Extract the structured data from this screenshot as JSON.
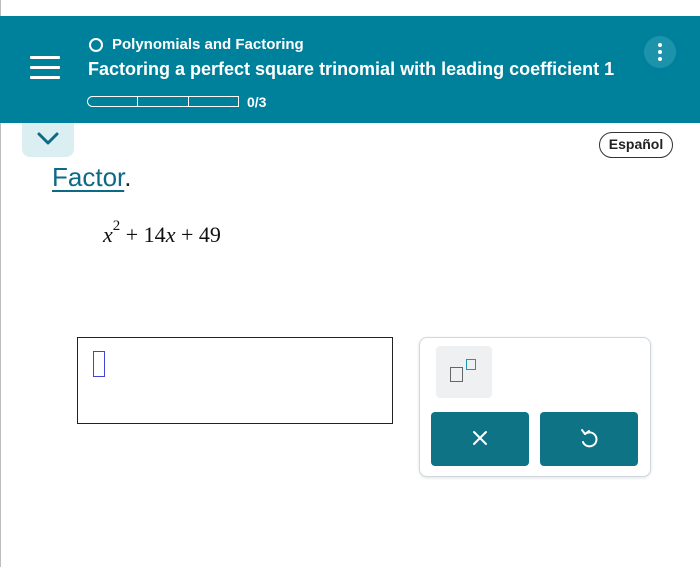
{
  "header": {
    "topic": "Polynomials and Factoring",
    "lesson": "Factoring a perfect square trinomial with leading coefficient 1",
    "progress_text": "0/3",
    "progress_fraction": 0,
    "background_color": "#00819b"
  },
  "language_button": {
    "label": "Español"
  },
  "problem": {
    "instruction_word": "Factor",
    "instruction_punct": ".",
    "expression": {
      "var": "x",
      "exponent": "2",
      "term2": "+ 14",
      "var2": "x",
      "term3": "+ 49"
    }
  },
  "answer": {
    "value": ""
  },
  "tools": {
    "exponent_button_icon": "superscript-template-icon",
    "clear_icon": "x-icon",
    "undo_icon": "undo-icon",
    "button_color": "#0e7385"
  },
  "icons": {
    "menu": "hamburger-icon",
    "more": "kebab-icon",
    "collapse": "chevron-down-icon"
  }
}
